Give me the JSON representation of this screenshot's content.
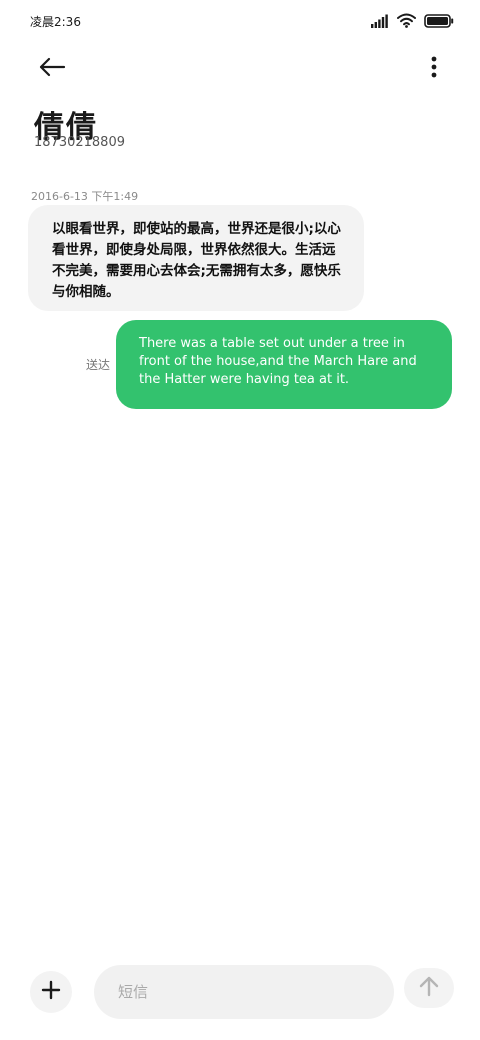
{
  "status_bar": {
    "time": "凌晨2:36",
    "icons": [
      "signal-icon",
      "wifi-icon",
      "battery-icon"
    ]
  },
  "header": {
    "contact_name": "倩倩",
    "contact_number": "18730218809",
    "icons": [
      "back-arrow-icon",
      "more-vertical-icon"
    ]
  },
  "conversation": {
    "timestamp": "2016-6-13 下午1:49",
    "messages": [
      {
        "direction": "incoming",
        "text": "以眼看世界，即使站的最高，世界还是很小;以心看世界，即使身处局限，世界依然很大。生活远不完美，需要用心去体会;无需拥有太多，愿快乐与你相随。"
      },
      {
        "direction": "outgoing",
        "text": "There was a table set out under a tree in front of the house,and the March Hare and the Hatter were having tea at it.",
        "status": "送达"
      }
    ]
  },
  "composer": {
    "placeholder": "短信",
    "value": "",
    "icons": [
      "plus-icon",
      "send-arrow-icon"
    ]
  },
  "colors": {
    "outgoing_bubble": "#33c26e",
    "incoming_bubble": "#f3f3f3",
    "background": "#ffffff"
  }
}
